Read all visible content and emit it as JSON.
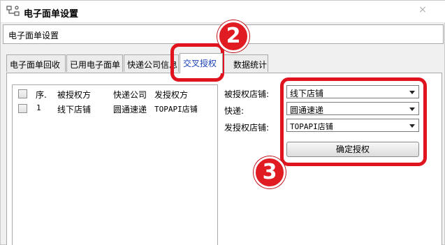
{
  "window": {
    "title": "电子面单设置",
    "close_glyph": "×"
  },
  "header": {
    "text": "电子面单设置"
  },
  "tabs": [
    {
      "label": "电子面单回收"
    },
    {
      "label": "已用电子面单"
    },
    {
      "label": "快递公司信息"
    },
    {
      "label": "交叉授权"
    },
    {
      "label": "数据统计"
    }
  ],
  "list": {
    "columns": [
      "序.",
      "被授权方",
      "快递公司",
      "发授权方"
    ],
    "rows": [
      {
        "index": "1",
        "grantee": "线下店铺",
        "courier": "圆通速递",
        "grantor": "TOPAPI店铺"
      }
    ]
  },
  "form": {
    "grantee_label": "被授权店铺:",
    "grantee_value": "线下店铺",
    "courier_label": "快递:",
    "courier_value": "圆通速递",
    "grantor_label": "发授权店铺:",
    "grantor_value": "TOPAPI店铺",
    "confirm_label": "确定授权"
  },
  "annotations": {
    "step2": "2",
    "step3": "3"
  },
  "colors": {
    "highlight": "#e0141e",
    "active_tab_text": "#1a3fb8"
  }
}
